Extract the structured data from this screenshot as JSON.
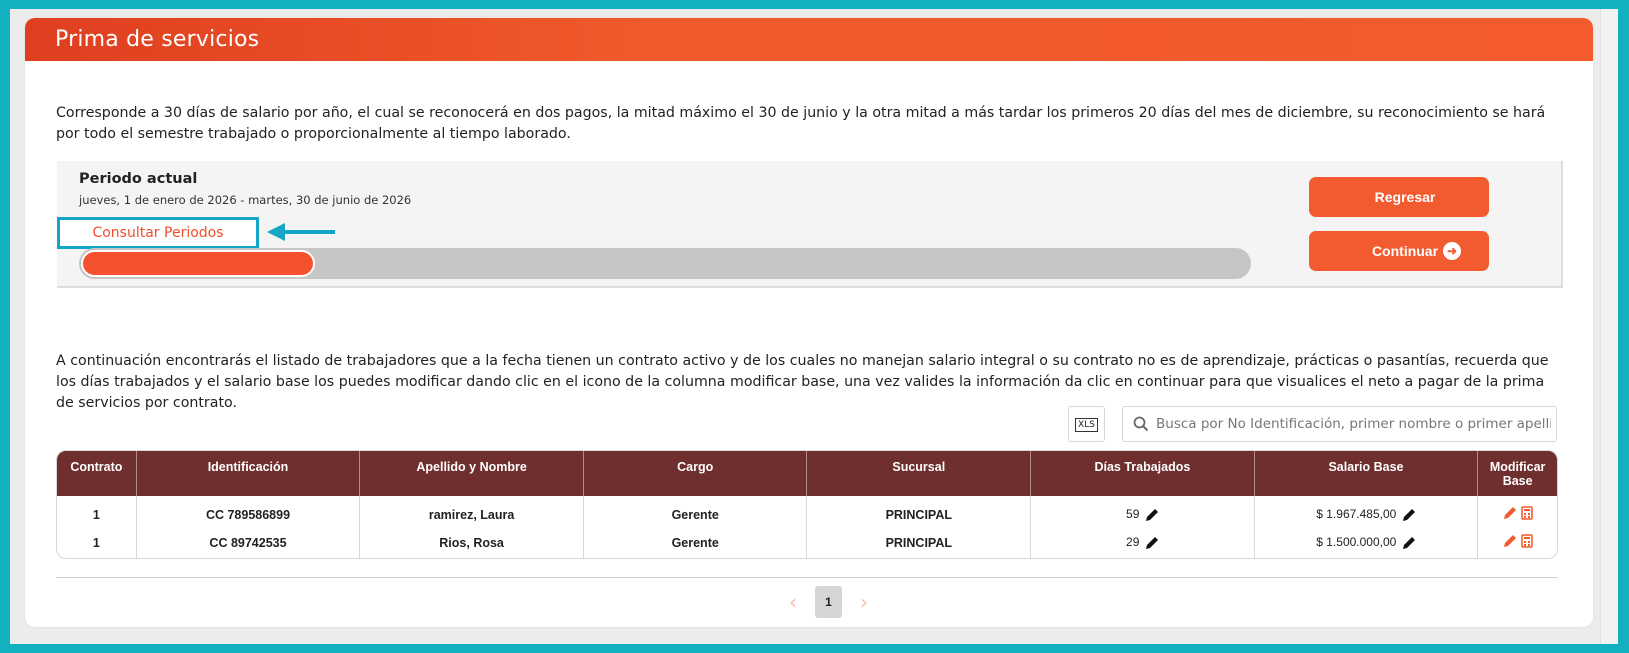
{
  "header": {
    "title": "Prima de servicios"
  },
  "description": "Corresponde a 30 días de salario por año, el cual se reconocerá en dos pagos, la mitad máximo el 30 de junio y la otra mitad a más tardar los primeros 20 días del mes de diciembre, su reconocimiento se hará por todo el semestre trabajado o proporcionalmente al tiempo laborado.",
  "period": {
    "title": "Periodo actual",
    "dates": "jueves, 1 de enero de 2026 - martes, 30 de junio de 2026",
    "consult_link": "Consultar Periodos",
    "progress_fraction": 0.2
  },
  "actions": {
    "back": "Regresar",
    "next": "Continuar"
  },
  "instructions": "A continuación encontrarás el listado de trabajadores que a la fecha tienen un contrato activo y de los cuales no manejan salario integral o su contrato no es de aprendizaje, prácticas o pasantías, recuerda que los días trabajados y el salario base los puedes modificar dando clic en el icono de la columna modificar base, una vez valides la información da clic en continuar para que visualices el neto a pagar de la prima de servicios por contrato.",
  "toolbar": {
    "excel_label": "XLS",
    "search_placeholder": "Busca por No Identificación, primer nombre o primer apellido"
  },
  "table": {
    "headers": [
      "Contrato",
      "Identificación",
      "Apellido y Nombre",
      "Cargo",
      "Sucursal",
      "Días Trabajados",
      "Salario Base",
      "Modificar Base"
    ],
    "rows": [
      {
        "contrato": "1",
        "id": "CC 789586899",
        "nombre": "ramirez, Laura",
        "cargo": "Gerente",
        "sucursal": "PRINCIPAL",
        "dias": "59",
        "salario": "$ 1.967.485,00"
      },
      {
        "contrato": "1",
        "id": "CC 89742535",
        "nombre": "Rios, Rosa",
        "cargo": "Gerente",
        "sucursal": "PRINCIPAL",
        "dias": "29",
        "salario": "$ 1.500.000,00"
      }
    ]
  },
  "pagination": {
    "current": "1"
  },
  "colors": {
    "accent": "#f25a30",
    "table_header": "#6f2f2f",
    "highlight": "#16a5c4",
    "frame": "#13b0bf"
  }
}
